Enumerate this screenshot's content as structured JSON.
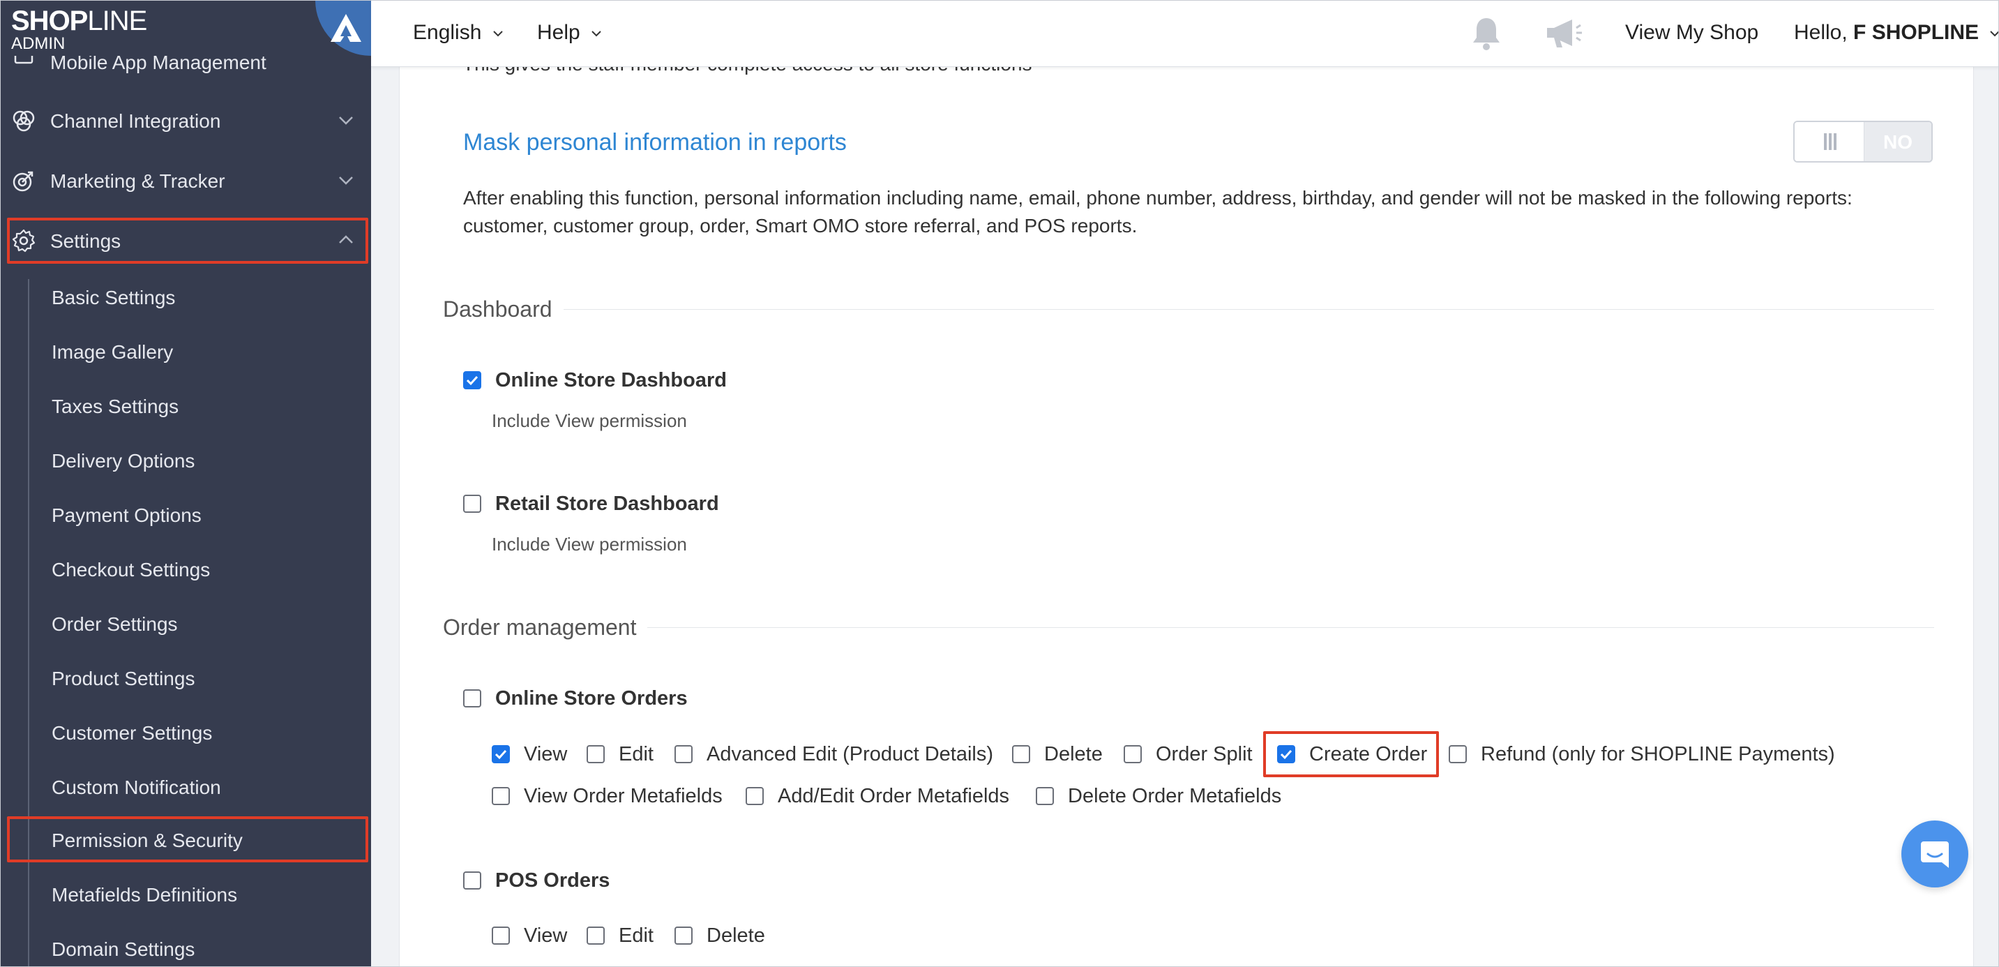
{
  "brand": {
    "logo_bold": "SHOP",
    "logo_thin": "LINE",
    "subtitle": "ADMIN"
  },
  "sidebar": {
    "cut_item": "Mobile App Management",
    "items": [
      {
        "label": "Channel Integration",
        "icon": "channel-icon"
      },
      {
        "label": "Marketing & Tracker",
        "icon": "target-icon"
      },
      {
        "label": "Settings",
        "icon": "gear-icon"
      }
    ],
    "sub_items": [
      "Basic Settings",
      "Image Gallery",
      "Taxes Settings",
      "Delivery Options",
      "Payment Options",
      "Checkout Settings",
      "Order Settings",
      "Product Settings",
      "Customer Settings",
      "Custom Notification",
      "Permission & Security",
      "Metafields Definitions",
      "Domain Settings"
    ]
  },
  "topbar": {
    "language": "English",
    "help": "Help",
    "view_shop": "View My Shop",
    "greeting": "Hello,",
    "user": "F SHOPLINE"
  },
  "main": {
    "cut_text": "This gives the staff member complete access to all store functions",
    "mask": {
      "title": "Mask personal information in reports",
      "toggle_label": "NO",
      "description": "After enabling this function, personal information including name, email, phone number, address, birthday, and gender will not be masked in the following reports: customer, customer group, order, Smart OMO store referral, and POS reports."
    },
    "dashboard": {
      "title": "Dashboard",
      "online": {
        "label": "Online Store Dashboard",
        "checked": true,
        "hint": "Include View permission"
      },
      "retail": {
        "label": "Retail Store Dashboard",
        "checked": false,
        "hint": "Include View permission"
      }
    },
    "orders": {
      "title": "Order management",
      "online": {
        "label": "Online Store Orders",
        "options": [
          {
            "label": "View",
            "checked": true
          },
          {
            "label": "Edit",
            "checked": false
          },
          {
            "label": "Advanced Edit (Product Details)",
            "checked": false
          },
          {
            "label": "Delete",
            "checked": false
          },
          {
            "label": "Order Split",
            "checked": false
          },
          {
            "label": "Create Order",
            "checked": true
          },
          {
            "label": "Refund (only for SHOPLINE Payments)",
            "checked": false
          },
          {
            "label": "View Order Metafields",
            "checked": false
          },
          {
            "label": "Add/Edit Order Metafields",
            "checked": false
          },
          {
            "label": "Delete Order Metafields",
            "checked": false
          }
        ]
      },
      "pos": {
        "label": "POS Orders",
        "options": [
          {
            "label": "View",
            "checked": false
          },
          {
            "label": "Edit",
            "checked": false
          },
          {
            "label": "Delete",
            "checked": false
          }
        ]
      }
    }
  },
  "colors": {
    "sidebar_bg": "#363c4f",
    "accent_blue": "#2e86d3",
    "checkbox_blue": "#1a73e8",
    "highlight_red": "#e03c27",
    "chat_fab": "#4b93ec"
  }
}
